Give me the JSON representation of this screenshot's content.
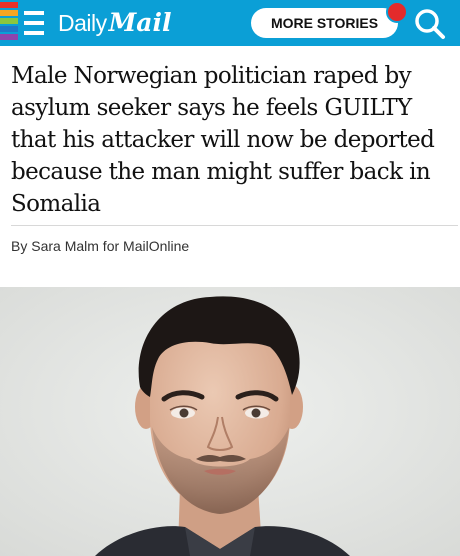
{
  "header": {
    "brand_daily": "Daily",
    "brand_mail": "Mail",
    "more_stories_label": "MORE STORIES",
    "background_color": "#0b9fd6",
    "notification_color": "#e32b2b",
    "icons": [
      "menu-icon",
      "search-icon"
    ]
  },
  "article": {
    "headline": "Male Norwegian politician raped by asylum seeker says he feels GUILTY that his attacker will now be deported because the man might suffer back in Somalia",
    "byline": "By Sara Malm for MailOnline"
  }
}
